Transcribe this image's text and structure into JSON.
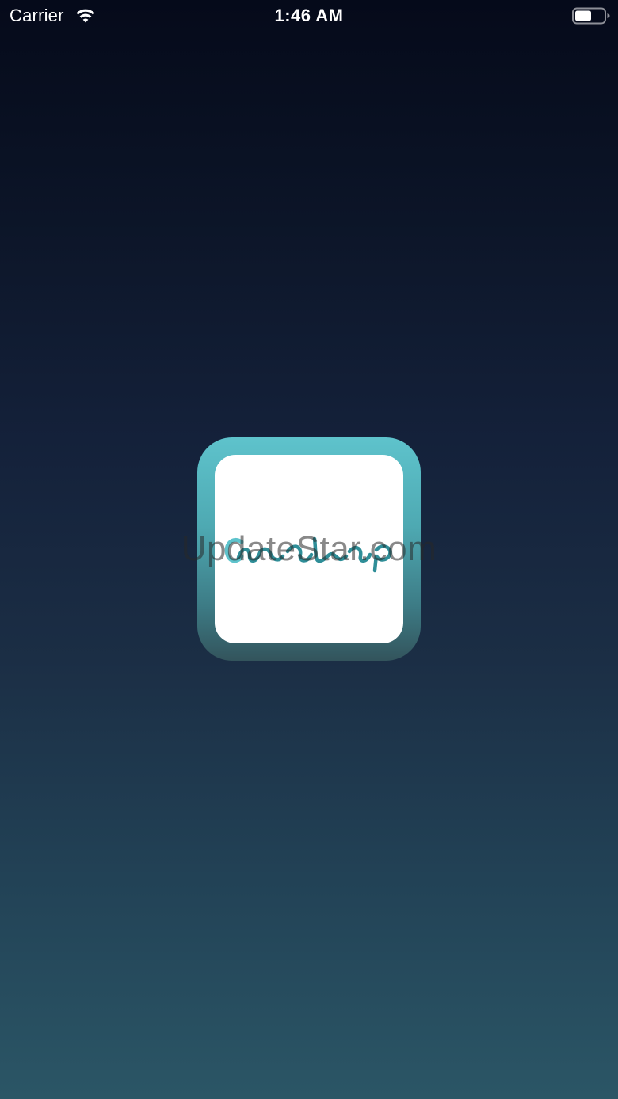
{
  "status_bar": {
    "carrier": "Carrier",
    "time": "1:46 AM",
    "wifi_icon": "wifi-icon",
    "battery_icon": "battery-icon"
  },
  "splash": {
    "logo_icon": "app-logo-icon",
    "watermark": "UpdateStar.com"
  },
  "colors": {
    "background_top": "#050a1a",
    "background_bottom": "#2b5666",
    "logo_accent": "#5ec3cc",
    "logo_script": "#2f8e98"
  }
}
